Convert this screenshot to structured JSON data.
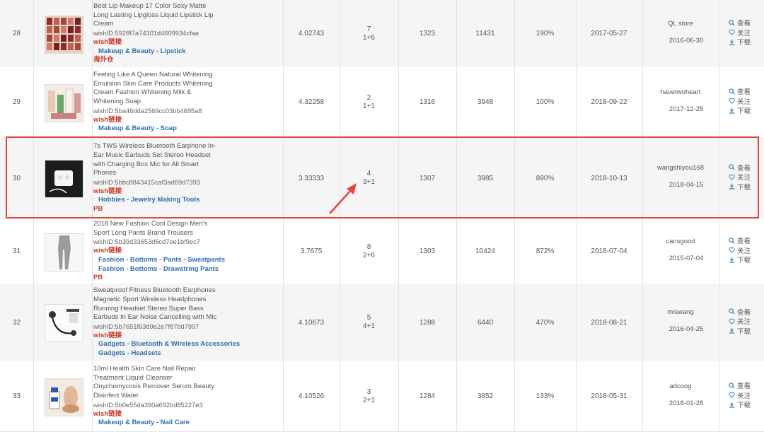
{
  "actions": {
    "view": "查看",
    "follow": "关注",
    "download": "下载"
  },
  "colors": {
    "highlight_column": "#e1f0fd",
    "category_link": "#2f6fb0",
    "wish_link": "#c83a2a",
    "annotation_red": "#e2463c"
  },
  "rows": [
    {
      "rank": "28",
      "title_lines": [
        "Best Lip Makeup 17 Color Sexy Matte",
        "Long Lasting Lipgloss Liquid Lipstick Lip",
        "Cream"
      ],
      "wish_id": "wishID:5928f7a74301d4609934cfaa",
      "wish_link": "wish链接",
      "categories": [
        [
          "Makeup & Beauty",
          "Lipstick"
        ]
      ],
      "tag": "海外仓",
      "rating": "4.02743",
      "reviews_top": "7",
      "reviews_bottom": "1+6",
      "sales": "1323",
      "col5": "11431",
      "growth": "190%",
      "date": "2017-05-27",
      "store": "QL store",
      "store_date": "2016-06-30",
      "thumb_icon": "lipstick-swatch-image"
    },
    {
      "rank": "29",
      "title_lines": [
        "Feeling Like A Queen Natural Whitening",
        "Emulsion Skin Care Products Whitening",
        "Cream Fashion Whitening Milk &",
        "Whitening Soap"
      ],
      "wish_id": "wishID:5ba46dda2569cc03bb4695a8",
      "wish_link": "wish链接",
      "categories": [
        [
          "Makeup & Beauty",
          "Soap"
        ]
      ],
      "tag": "",
      "rating": "4.32258",
      "reviews_top": "2",
      "reviews_bottom": "1+1",
      "sales": "1316",
      "col5": "3948",
      "growth": "100%",
      "date": "2018-09-22",
      "store": "havetwoheart",
      "store_date": "2017-12-25",
      "thumb_icon": "skincare-products-image"
    },
    {
      "rank": "30",
      "title_lines": [
        "7s TWS Wireless Bluetooth Earphone In-",
        "Ear Music Earbuds Set Stereo Headset",
        "with Charging Box Mic for All Smart",
        "Phones"
      ],
      "wish_id": "wishID:5bbc8843415caf3ad69d7393",
      "wish_link": "wish链接",
      "categories": [
        [
          "Hobbies",
          "Jewelry Making Tools"
        ]
      ],
      "tag": "PB",
      "rating": "3.33333",
      "reviews_top": "4",
      "reviews_bottom": "3+1",
      "sales": "1307",
      "col5": "3985",
      "growth": "890%",
      "date": "2018-10-13",
      "store": "wangshiyou168",
      "store_date": "2018-04-15",
      "thumb_icon": "earbuds-box-image"
    },
    {
      "rank": "31",
      "title_lines": [
        "2018 New Fashion Cool Design Men's",
        "Sport Long Pants Brand Trousers"
      ],
      "wish_id": "wishID:5b39d33653d6cd7ee1bf9ec7",
      "wish_link": "wish链接",
      "categories": [
        [
          "Fashion",
          "Bottoms",
          "Pants",
          "Sweatpants"
        ],
        [
          "Fashion",
          "Bottoms",
          "Drawstring Pants"
        ]
      ],
      "tag": "PB",
      "rating": "3.7675",
      "reviews_top": "8",
      "reviews_bottom": "2+6",
      "sales": "1303",
      "col5": "10424",
      "growth": "872%",
      "date": "2018-07-04",
      "store": "cansgood",
      "store_date": "2015-07-04",
      "thumb_icon": "sport-pants-image"
    },
    {
      "rank": "32",
      "title_lines": [
        "Sweatproof Fitness Bluetooth Earphones",
        "Magnetic Sport Wireless Headphones",
        "Running Headset Stereo Super Bass",
        "Earbuds In Ear Noise Cancelling with Mic"
      ],
      "wish_id": "wishID:5b7651f63d9e2e7f87bd7997",
      "wish_link": "wish链接",
      "categories": [
        [
          "Gadgets",
          "Bluetooth & Wireless Accessories"
        ],
        [
          "Gadgets",
          "Headsets"
        ]
      ],
      "tag": "",
      "rating": "4.10673",
      "reviews_top": "5",
      "reviews_bottom": "4+1",
      "sales": "1288",
      "col5": "6440",
      "growth": "470%",
      "date": "2018-08-21",
      "store": "miswang",
      "store_date": "2016-04-25",
      "thumb_icon": "sport-earphones-image"
    },
    {
      "rank": "33",
      "title_lines": [
        "10ml Health Skin Care Nail Repair",
        "Treatment Liquid Cleanser",
        "Onychomycosis Remover Serum Beauty",
        "Disinfect Water"
      ],
      "wish_id": "wishID:5b0e55da390a692bd85227e3",
      "wish_link": "wish链接",
      "categories": [
        [
          "Makeup & Beauty",
          "Nail Care"
        ]
      ],
      "tag": "",
      "rating": "4.10526",
      "reviews_top": "3",
      "reviews_bottom": "2+1",
      "sales": "1284",
      "col5": "3852",
      "growth": "133%",
      "date": "2018-05-31",
      "store": "adcoog",
      "store_date": "2018-01-28",
      "thumb_icon": "nail-serum-image"
    }
  ]
}
